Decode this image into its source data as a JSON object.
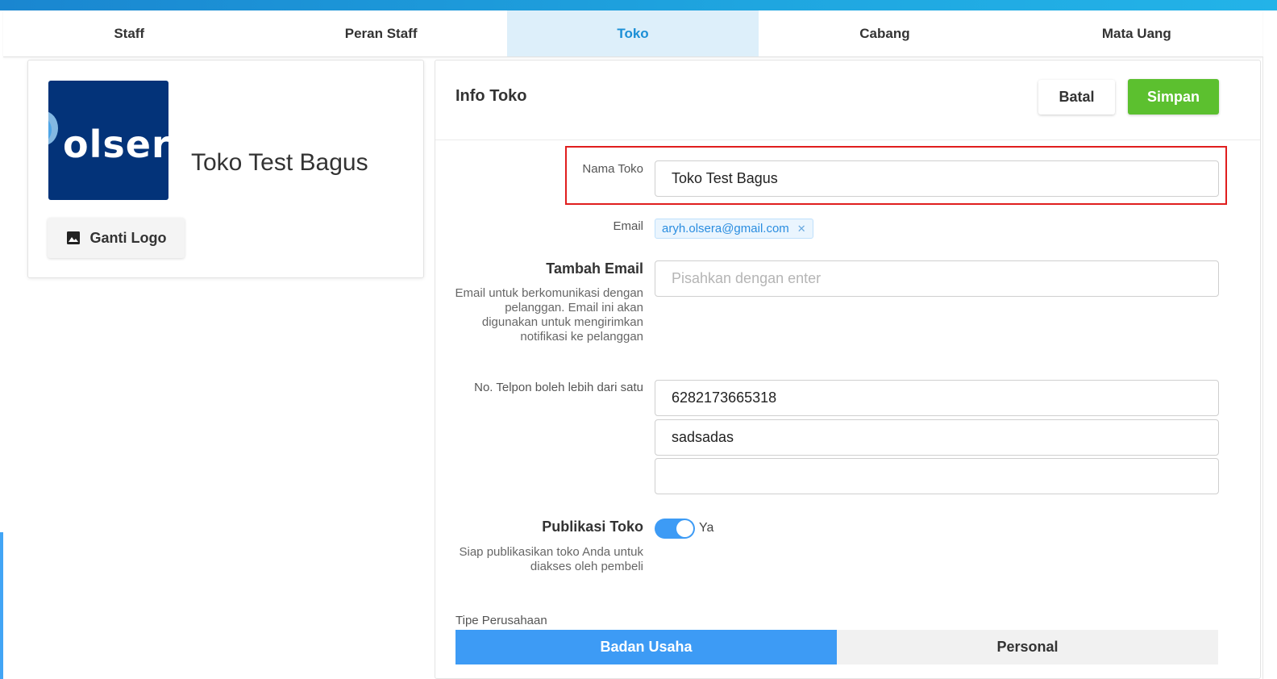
{
  "tabs": [
    "Staff",
    "Peran Staff",
    "Toko",
    "Cabang",
    "Mata Uang"
  ],
  "active_tab": "Toko",
  "logo_card": {
    "logo_text": "olser",
    "store_name": "Toko Test Bagus",
    "change_logo_label": "Ganti Logo"
  },
  "info": {
    "title": "Info Toko",
    "cancel_label": "Batal",
    "save_label": "Simpan",
    "store_name_label": "Nama Toko",
    "store_name_value": "Toko Test Bagus",
    "email_label": "Email",
    "email_chip": "aryh.olsera@gmail.com",
    "add_email_label": "Tambah Email",
    "add_email_placeholder": "Pisahkan dengan enter",
    "add_email_hint": [
      "Email untuk berkomunikasi dengan",
      "pelanggan. Email ini akan",
      "digunakan untuk mengirimkan",
      "notifikasi ke pelanggan"
    ],
    "phone_label": "No. Telpon boleh lebih dari satu",
    "phones": [
      "6282173665318",
      "sadsadas",
      ""
    ],
    "publish_label": "Publikasi Toko",
    "publish_value": "Ya",
    "publish_on": true,
    "publish_hint": [
      "Siap publikasikan toko Anda untuk",
      "diakses oleh pembeli"
    ],
    "company_type_label": "Tipe Perusahaan",
    "company_types": [
      "Badan Usaha",
      "Personal"
    ],
    "company_type_selected": "Badan Usaha"
  },
  "colors": {
    "accent": "#3d9bf5",
    "save_green": "#5cc02f",
    "highlight_red": "#e01e1e",
    "logo_bg": "#033379"
  }
}
